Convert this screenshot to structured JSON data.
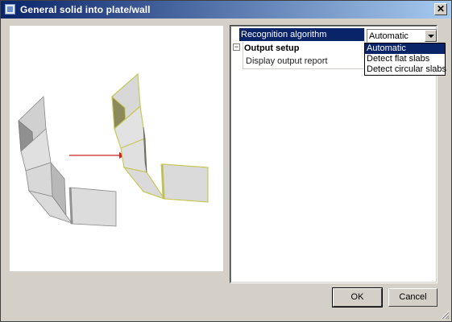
{
  "window": {
    "title": "General solid into plate/wall"
  },
  "properties": {
    "recognition_label": "Recognition algorithm",
    "recognition_value": "Automatic",
    "output_setup_label": "Output setup",
    "display_report_label": "Display output report"
  },
  "dropdown": {
    "options": [
      "Automatic",
      "Detect flat slabs",
      "Detect circular slabs"
    ]
  },
  "buttons": {
    "ok": "OK",
    "cancel": "Cancel"
  },
  "colors": {
    "titlebar_start": "#0a246a",
    "titlebar_end": "#a6caf0",
    "selection": "#0a246a",
    "arrow": "#cc2222",
    "highlight_edge": "#c8c85a"
  }
}
